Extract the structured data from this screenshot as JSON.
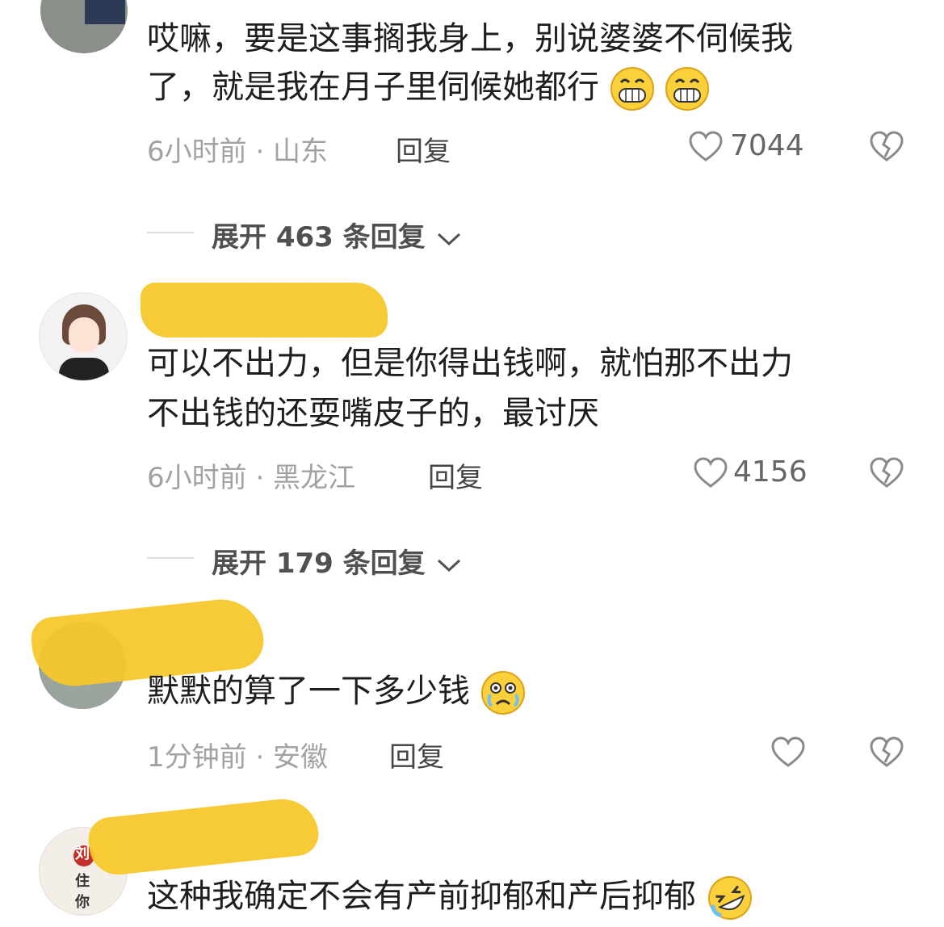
{
  "comments": [
    {
      "text_line1": "哎嘛，要是这事搁我身上，别说婆婆不伺候我",
      "text_line2": "了，就是我在月子里伺候她都行",
      "meta": "6小时前 · 山东",
      "reply": "回复",
      "likes": "7044",
      "expand": "展开 463 条回复",
      "emoji": "grinning-face"
    },
    {
      "text_line1": "可以不出力，但是你得出钱啊，就怕那不出力",
      "text_line2": "不出钱的还耍嘴皮子的，最讨厌",
      "meta": "6小时前 · 黑龙江",
      "reply": "回复",
      "likes": "4156",
      "expand": "展开 179 条回复"
    },
    {
      "text": "默默的算了一下多少钱",
      "meta": "1分钟前 · 安徽",
      "reply": "回复",
      "emoji": "crying-face"
    },
    {
      "text": "这种我确定不会有产前抑郁和产后抑郁",
      "emoji": "rolling-laughing-face"
    }
  ],
  "avatar4_text": [
    "刘",
    "住",
    "你"
  ],
  "colors": {
    "highlight": "#f6c82c",
    "text": "#1e1e1e",
    "meta": "#a2a2a2"
  },
  "icons": [
    "heart-icon",
    "broken-heart-icon",
    "chevron-down-icon"
  ]
}
